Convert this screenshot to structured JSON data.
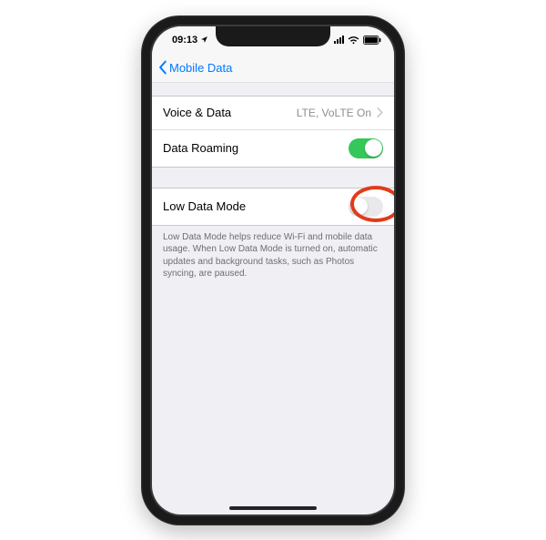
{
  "status": {
    "time": "09:13"
  },
  "nav": {
    "back_label": "Mobile Data"
  },
  "group1": {
    "voice_data": {
      "label": "Voice & Data",
      "value": "LTE, VoLTE On"
    },
    "data_roaming": {
      "label": "Data Roaming",
      "on": true
    }
  },
  "group2": {
    "low_data_mode": {
      "label": "Low Data Mode",
      "on": false
    },
    "footer": "Low Data Mode helps reduce Wi-Fi and mobile data usage. When Low Data Mode is turned on, automatic updates and background tasks, such as Photos syncing, are paused."
  }
}
